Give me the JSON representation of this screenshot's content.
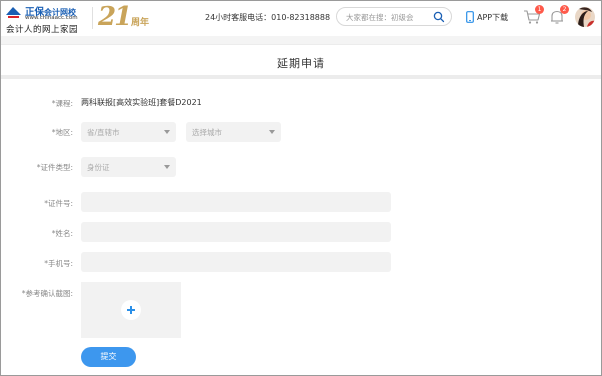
{
  "header": {
    "logo_name_big": "正保",
    "logo_name": "会计网校",
    "logo_url": "www.chinaacc.com",
    "logo_slogan": "会计人的网上家园",
    "anniversary_number": "21",
    "anniversary_label": "周年",
    "hotline": "24小时客服电话：010-82318888",
    "search_placeholder": "大家都在搜：初级会",
    "app_download": "APP下载",
    "cart_badge": "1",
    "bell_badge": "2",
    "colors": {
      "brand_blue": "#1a5fb4",
      "gold": "#c9a45a",
      "badge_red": "#ff5a4b"
    }
  },
  "page": {
    "title": "延期申请"
  },
  "form": {
    "course_label": "*课程:",
    "course_value": "两科联报[高效实验班]套餐D2021",
    "region_label": "*地区:",
    "province_placeholder": "省/直辖市",
    "city_placeholder": "选择城市",
    "id_type_label": "*证件类型:",
    "id_type_value": "身份证",
    "id_number_label": "*证件号:",
    "name_label": "*姓名:",
    "phone_label": "*手机号:",
    "screenshot_label": "*参考确认截图:",
    "submit_label": "提交",
    "colors": {
      "accent": "#3d97ee",
      "field_bg": "#f2f2f2"
    }
  }
}
